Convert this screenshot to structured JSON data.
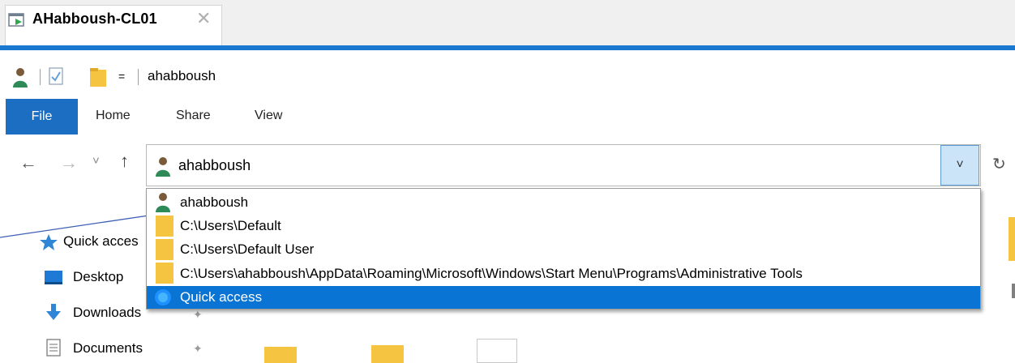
{
  "tab": {
    "title": "AHabboush-CL01",
    "close": "✕"
  },
  "window": {
    "title": "ahabboush"
  },
  "quick_access_toolbar": {
    "customize": "="
  },
  "ribbon": {
    "tabs": [
      "File",
      "Home",
      "Share",
      "View"
    ]
  },
  "navigation": {
    "back": "←",
    "forward": "→",
    "recent": "˅",
    "up": "↑",
    "refresh": "↻"
  },
  "address": {
    "value": "ahabboush",
    "dropdown_chevron": "˅"
  },
  "dropdown": {
    "items": [
      {
        "label": "ahabboush",
        "icon": "user-icon"
      },
      {
        "label": "C:\\Users\\Default",
        "icon": "folder-icon"
      },
      {
        "label": "C:\\Users\\Default User",
        "icon": "folder-icon"
      },
      {
        "label": "C:\\Users\\ahabboush\\AppData\\Roaming\\Microsoft\\Windows\\Start Menu\\Programs\\Administrative Tools",
        "icon": "folder-icon"
      },
      {
        "label": "Quick access",
        "icon": "quick-access-icon",
        "selected": true
      }
    ]
  },
  "nav_pane": {
    "items": [
      {
        "label": "Quick acces",
        "icon": "star-icon"
      },
      {
        "label": "Desktop",
        "icon": "desktop-icon"
      },
      {
        "label": "Downloads",
        "icon": "download-icon"
      },
      {
        "label": "Documents",
        "icon": "documents-icon"
      }
    ]
  },
  "colors": {
    "accent": "#1b78d0",
    "selection": "#0a74d4",
    "file_tab": "#1b6ec2",
    "folder": "#f5c542"
  }
}
